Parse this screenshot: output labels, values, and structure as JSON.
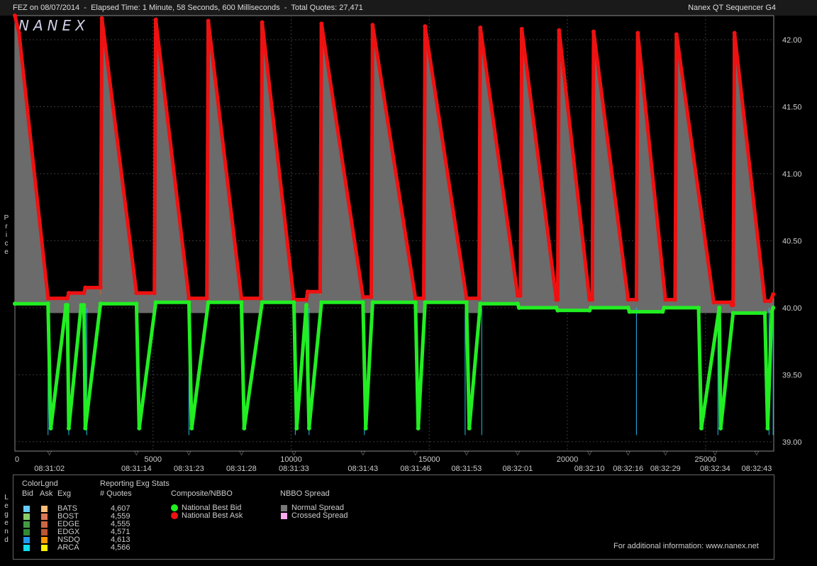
{
  "header": {
    "left": "FEZ on 08/07/2014  -  Elapsed Time: 1 Minute, 58 Seconds, 600 Milliseconds  -  Total Quotes: 27,471",
    "right": "Nanex QT Sequencer G4"
  },
  "watermark": "NANEX",
  "price_axis_label": "Price",
  "legend_axis_label": "Legend",
  "colors": {
    "bid_line": "#22ee22",
    "ask_line": "#ee1111",
    "spread_fill": "#6b6b6b",
    "grid": "#3a3a3a",
    "axis": "#888888"
  },
  "chart_data": {
    "type": "line",
    "title": "",
    "xlabel": "",
    "ylabel": "Price",
    "x_ticks": [
      0,
      5000,
      10000,
      15000,
      20000,
      25000
    ],
    "xlim": [
      0,
      27471
    ],
    "ylim": [
      38.93,
      42.18
    ],
    "y_ticks": [
      "42.00",
      "41.50",
      "41.00",
      "40.50",
      "40.00",
      "39.50",
      "39.00"
    ],
    "time_labels": [
      {
        "x": 1250,
        "label": "08:31:02"
      },
      {
        "x": 4400,
        "label": "08:31:14"
      },
      {
        "x": 6300,
        "label": "08:31:23"
      },
      {
        "x": 8200,
        "label": "08:31:28"
      },
      {
        "x": 10100,
        "label": "08:31:33"
      },
      {
        "x": 12600,
        "label": "08:31:43"
      },
      {
        "x": 14500,
        "label": "08:31:46"
      },
      {
        "x": 16350,
        "label": "08:31:53"
      },
      {
        "x": 18200,
        "label": "08:32:01"
      },
      {
        "x": 20800,
        "label": "08:32:10"
      },
      {
        "x": 22200,
        "label": "08:32:16"
      },
      {
        "x": 23550,
        "label": "08:32:29"
      },
      {
        "x": 25350,
        "label": "08:32:34"
      },
      {
        "x": 27450,
        "label": "08:32:43"
      }
    ],
    "series": [
      {
        "name": "National Best Ask",
        "color": "#ee1111",
        "points": [
          [
            0,
            42.18
          ],
          [
            150,
            42.05
          ],
          [
            1200,
            40.07
          ],
          [
            1900,
            40.07
          ],
          [
            1950,
            40.11
          ],
          [
            2500,
            40.11
          ],
          [
            2550,
            40.15
          ],
          [
            3100,
            40.15
          ],
          [
            3150,
            42.16
          ],
          [
            4400,
            40.11
          ],
          [
            5050,
            40.11
          ],
          [
            5100,
            42.15
          ],
          [
            6300,
            40.07
          ],
          [
            6950,
            40.07
          ],
          [
            7000,
            42.14
          ],
          [
            8200,
            40.07
          ],
          [
            8900,
            40.07
          ],
          [
            8950,
            42.13
          ],
          [
            10100,
            40.06
          ],
          [
            10550,
            40.06
          ],
          [
            10600,
            40.12
          ],
          [
            11050,
            40.12
          ],
          [
            11100,
            42.12
          ],
          [
            12600,
            40.08
          ],
          [
            12900,
            40.08
          ],
          [
            12950,
            42.11
          ],
          [
            14500,
            40.07
          ],
          [
            14800,
            40.07
          ],
          [
            14850,
            42.1
          ],
          [
            16350,
            40.07
          ],
          [
            16800,
            40.07
          ],
          [
            16850,
            42.09
          ],
          [
            18200,
            40.09
          ],
          [
            18300,
            40.09
          ],
          [
            18350,
            42.08
          ],
          [
            19600,
            40.06
          ],
          [
            19650,
            40.06
          ],
          [
            19700,
            42.07
          ],
          [
            20800,
            40.06
          ],
          [
            20900,
            40.06
          ],
          [
            20950,
            42.06
          ],
          [
            22200,
            40.06
          ],
          [
            22500,
            40.06
          ],
          [
            22550,
            42.05
          ],
          [
            23550,
            40.06
          ],
          [
            23900,
            40.06
          ],
          [
            23950,
            42.04
          ],
          [
            25300,
            40.04
          ],
          [
            25900,
            40.04
          ],
          [
            25950,
            40.02
          ],
          [
            26000,
            40.02
          ],
          [
            26050,
            42.05
          ],
          [
            27150,
            40.05
          ],
          [
            27350,
            40.05
          ],
          [
            27450,
            40.1
          ]
        ]
      },
      {
        "name": "National Best Bid",
        "color": "#22ee22",
        "points": [
          [
            0,
            40.03
          ],
          [
            1200,
            40.03
          ],
          [
            1300,
            39.1
          ],
          [
            1850,
            40.02
          ],
          [
            1900,
            40.02
          ],
          [
            1950,
            39.1
          ],
          [
            2400,
            40.02
          ],
          [
            2500,
            40.02
          ],
          [
            2550,
            39.1
          ],
          [
            3100,
            40.03
          ],
          [
            4400,
            40.03
          ],
          [
            4500,
            39.1
          ],
          [
            5100,
            40.04
          ],
          [
            6300,
            40.04
          ],
          [
            6400,
            39.1
          ],
          [
            7000,
            40.04
          ],
          [
            8200,
            40.04
          ],
          [
            8300,
            39.1
          ],
          [
            8950,
            40.04
          ],
          [
            10100,
            40.04
          ],
          [
            10200,
            39.1
          ],
          [
            10550,
            40.02
          ],
          [
            10650,
            39.1
          ],
          [
            11100,
            40.04
          ],
          [
            12600,
            40.04
          ],
          [
            12700,
            39.1
          ],
          [
            12950,
            40.04
          ],
          [
            14500,
            40.04
          ],
          [
            14600,
            39.1
          ],
          [
            14850,
            40.04
          ],
          [
            16350,
            40.04
          ],
          [
            16450,
            39.1
          ],
          [
            16850,
            40.03
          ],
          [
            18200,
            40.03
          ],
          [
            18250,
            40.0
          ],
          [
            19600,
            40.0
          ],
          [
            19650,
            39.98
          ],
          [
            20800,
            39.98
          ],
          [
            20850,
            40.0
          ],
          [
            22200,
            40.0
          ],
          [
            22250,
            39.97
          ],
          [
            23450,
            39.97
          ],
          [
            23500,
            40.0
          ],
          [
            24750,
            40.0
          ],
          [
            24850,
            39.1
          ],
          [
            25500,
            40.0
          ],
          [
            25550,
            39.1
          ],
          [
            26000,
            39.96
          ],
          [
            27150,
            39.96
          ],
          [
            27250,
            39.1
          ],
          [
            27400,
            39.97
          ],
          [
            27450,
            40.0
          ]
        ]
      }
    ],
    "stray_bid_drops": [
      1200,
      1950,
      2600,
      6300,
      10150,
      10650,
      12650,
      16300,
      16900,
      22500,
      25450,
      27300,
      27450
    ]
  },
  "legend": {
    "colorlgnd": {
      "title": "ColorLgnd",
      "headers": [
        "Bid",
        "Ask",
        "Exg"
      ],
      "rows": [
        {
          "exg": "BATS",
          "bid": "#66ccff",
          "ask": "#ffbb77"
        },
        {
          "exg": "BOST",
          "bid": "#88cc66",
          "ask": "#dd7755"
        },
        {
          "exg": "EDGE",
          "bid": "#449944",
          "ask": "#cc6644"
        },
        {
          "exg": "EDGX",
          "bid": "#338833",
          "ask": "#bb5533"
        },
        {
          "exg": "NSDQ",
          "bid": "#2299ee",
          "ask": "#ff9900"
        },
        {
          "exg": "ARCA",
          "bid": "#11ddee",
          "ask": "#ffee00"
        }
      ]
    },
    "exg_stats": {
      "title": "Reporting Exg Stats",
      "header": "# Quotes",
      "values": [
        "4,607",
        "4,559",
        "4,555",
        "4,571",
        "4,613",
        "4,566"
      ]
    },
    "composite": {
      "title": "Composite/NBBO",
      "items": [
        {
          "label": "National Best Bid",
          "color": "#22ee22"
        },
        {
          "label": "National Best Ask",
          "color": "#ee1111"
        }
      ]
    },
    "spread": {
      "title": "NBBO Spread",
      "items": [
        {
          "label": "Normal Spread",
          "color": "#777777"
        },
        {
          "label": "Crossed Spread",
          "color": "#ffaaee"
        }
      ]
    },
    "info": "For additional information: www.nanex.net"
  }
}
